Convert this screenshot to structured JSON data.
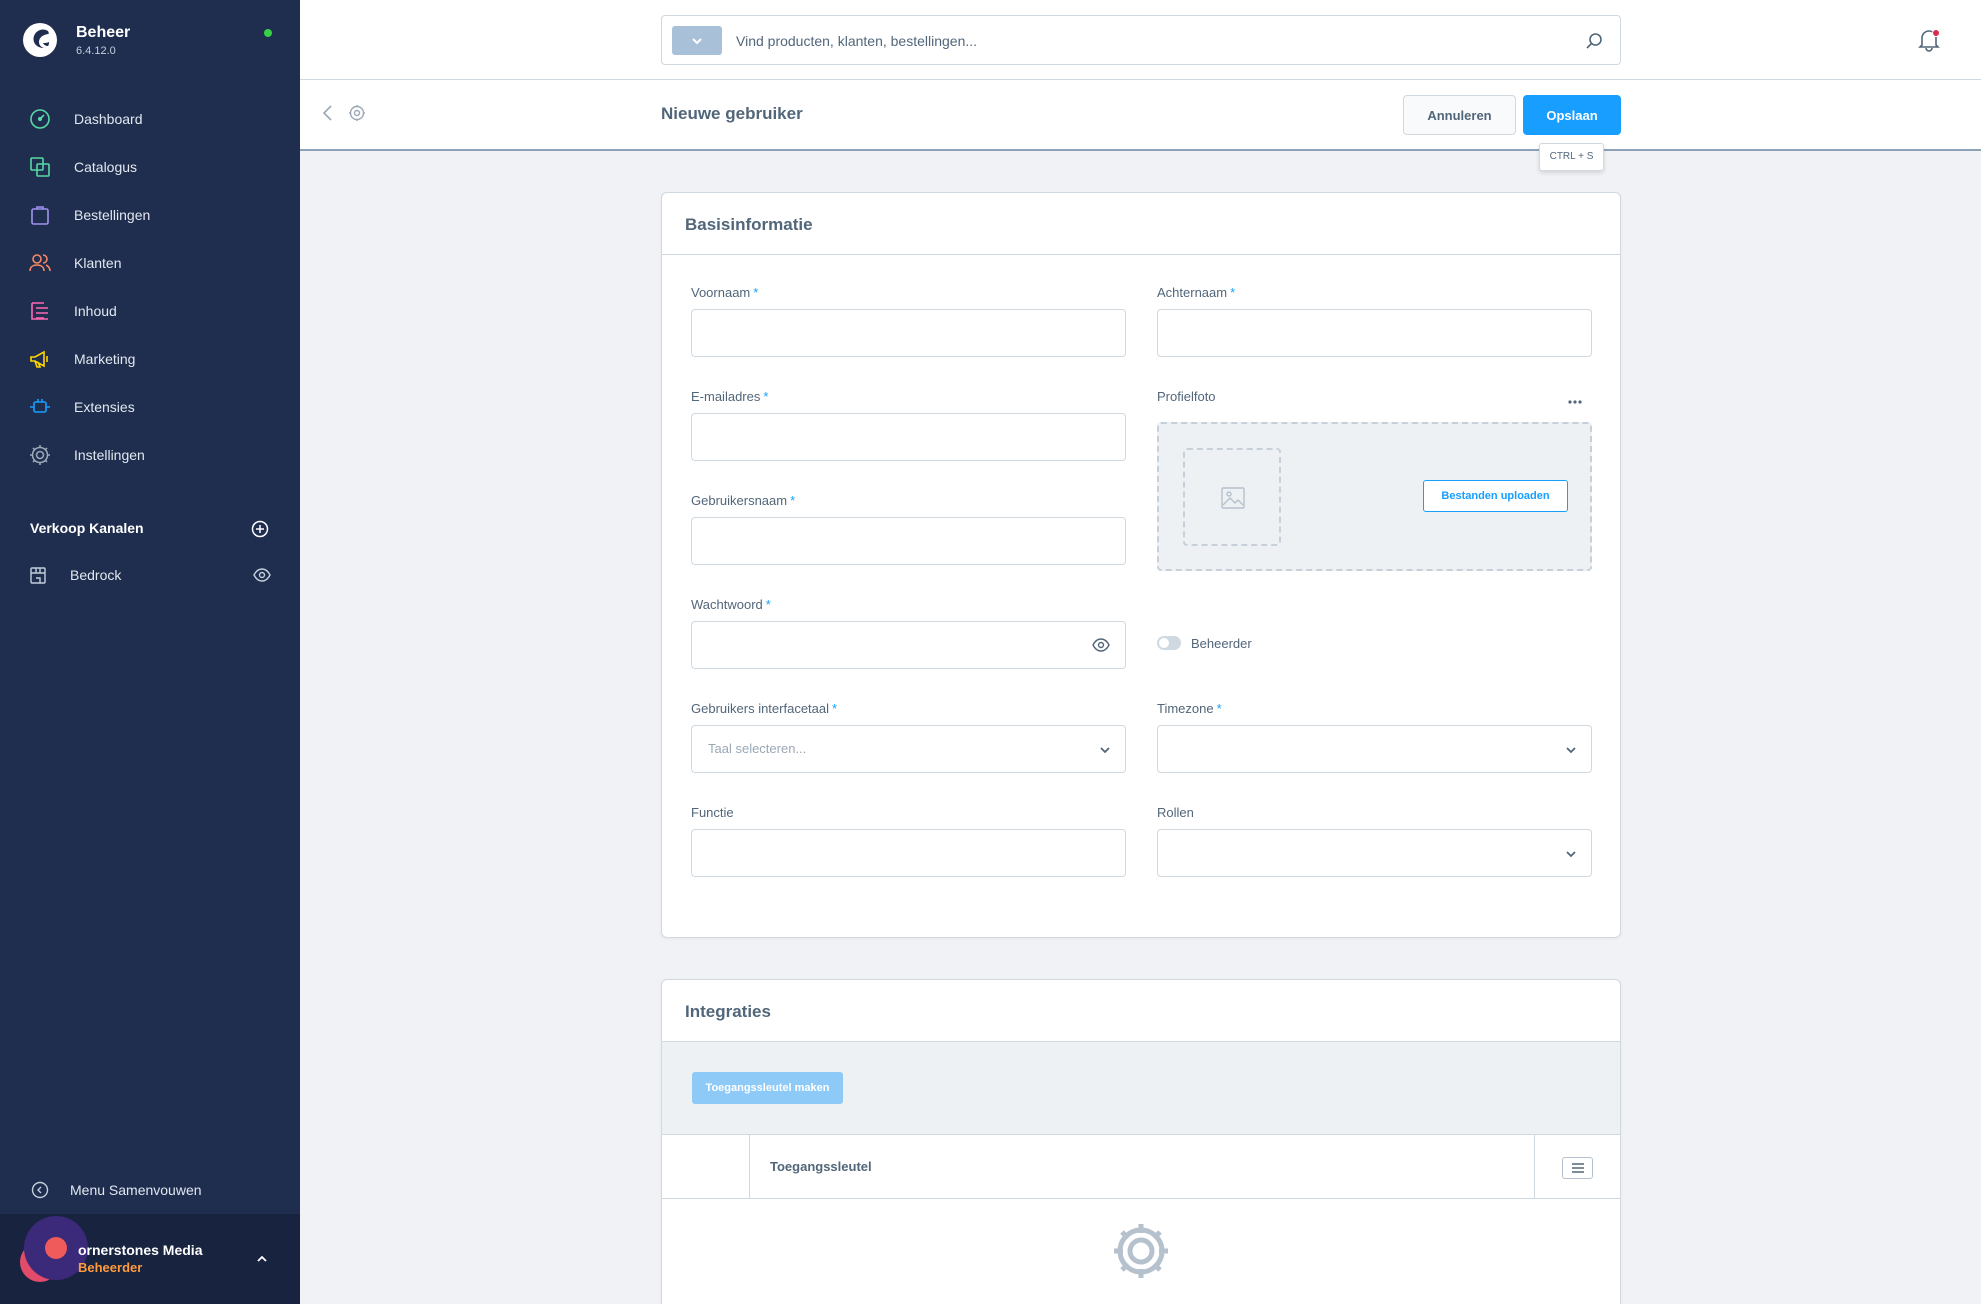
{
  "app": {
    "title": "Beheer",
    "version": "6.4.12.0"
  },
  "sidebar": {
    "items": [
      {
        "label": "Dashboard",
        "icon": "dashboard-icon",
        "color": "#57d9a3"
      },
      {
        "label": "Catalogus",
        "icon": "catalog-icon",
        "color": "#57d9a3"
      },
      {
        "label": "Bestellingen",
        "icon": "orders-icon",
        "color": "#a092f0"
      },
      {
        "label": "Klanten",
        "icon": "customers-icon",
        "color": "#f88962"
      },
      {
        "label": "Inhoud",
        "icon": "content-icon",
        "color": "#ff68b4"
      },
      {
        "label": "Marketing",
        "icon": "marketing-icon",
        "color": "#ffd700"
      },
      {
        "label": "Extensies",
        "icon": "extensions-icon",
        "color": "#189eff"
      },
      {
        "label": "Instellingen",
        "icon": "settings-icon",
        "color": "#9aa8b5"
      }
    ],
    "channels_heading": "Verkoop Kanalen",
    "channels": [
      {
        "label": "Bedrock"
      }
    ],
    "collapse_label": "Menu Samenvouwen",
    "user": {
      "name": "ornerstones Media",
      "role": "Beheerder"
    }
  },
  "search": {
    "placeholder": "Vind producten, klanten, bestellingen..."
  },
  "smartbar": {
    "title": "Nieuwe gebruiker",
    "cancel_label": "Annuleren",
    "save_label": "Opslaan",
    "save_shortcut": "CTRL + S"
  },
  "basis": {
    "title": "Basisinformatie",
    "first_name": {
      "label": "Voornaam",
      "required": "*",
      "value": ""
    },
    "last_name": {
      "label": "Achternaam",
      "required": "*",
      "value": ""
    },
    "email": {
      "label": "E-mailadres",
      "required": "*",
      "value": ""
    },
    "profile_photo": {
      "label": "Profielfoto",
      "upload_label": "Bestanden uploaden"
    },
    "username": {
      "label": "Gebruikersnaam",
      "required": "*",
      "value": ""
    },
    "password": {
      "label": "Wachtwoord",
      "required": "*",
      "value": ""
    },
    "admin_toggle": {
      "label": "Beheerder",
      "on": false
    },
    "locale": {
      "label": "Gebruikers interfacetaal",
      "required": "*",
      "placeholder": "Taal selecteren..."
    },
    "timezone": {
      "label": "Timezone",
      "required": "*",
      "value": ""
    },
    "job_title": {
      "label": "Functie",
      "value": ""
    },
    "roles": {
      "label": "Rollen",
      "value": ""
    }
  },
  "integrations": {
    "title": "Integraties",
    "create_key_label": "Toegangssleutel maken",
    "column_key": "Toegangssleutel"
  },
  "colors": {
    "primary": "#189eff",
    "sidebar": "#1f2d4e",
    "online": "#37d046"
  }
}
